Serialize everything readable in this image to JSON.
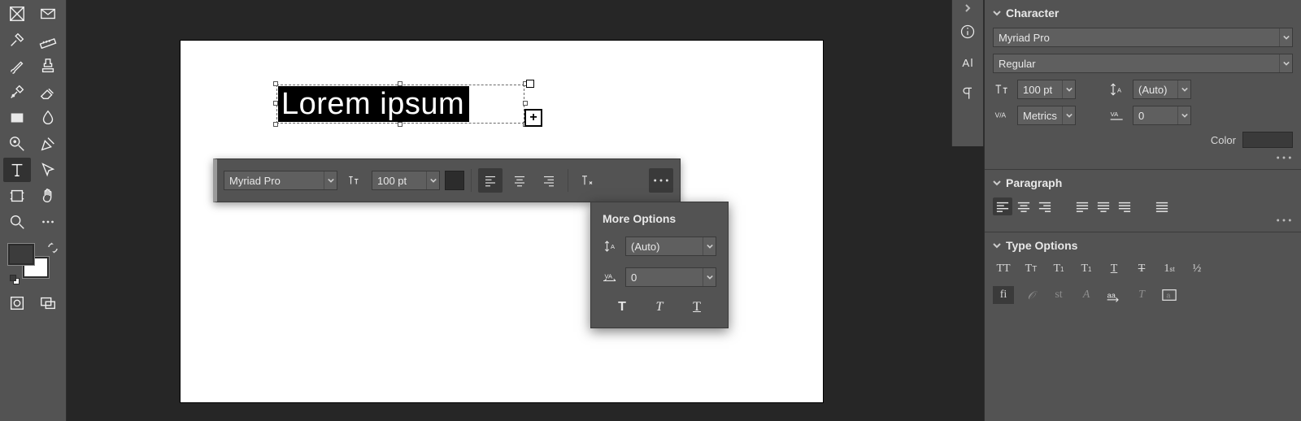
{
  "canvas": {
    "sample_text": "Lorem ipsum",
    "plus_port": "+"
  },
  "control_bar": {
    "font_family": "Myriad Pro",
    "font_size": "100 pt"
  },
  "popover": {
    "title": "More Options",
    "leading": "(Auto)",
    "tracking": "0"
  },
  "panels": {
    "character": {
      "title": "Character",
      "font_family": "Myriad Pro",
      "font_style": "Regular",
      "font_size": "100 pt",
      "leading": "(Auto)",
      "kerning": "Metrics",
      "tracking": "0",
      "color_label": "Color"
    },
    "paragraph": {
      "title": "Paragraph"
    },
    "type_options": {
      "title": "Type Options"
    }
  }
}
